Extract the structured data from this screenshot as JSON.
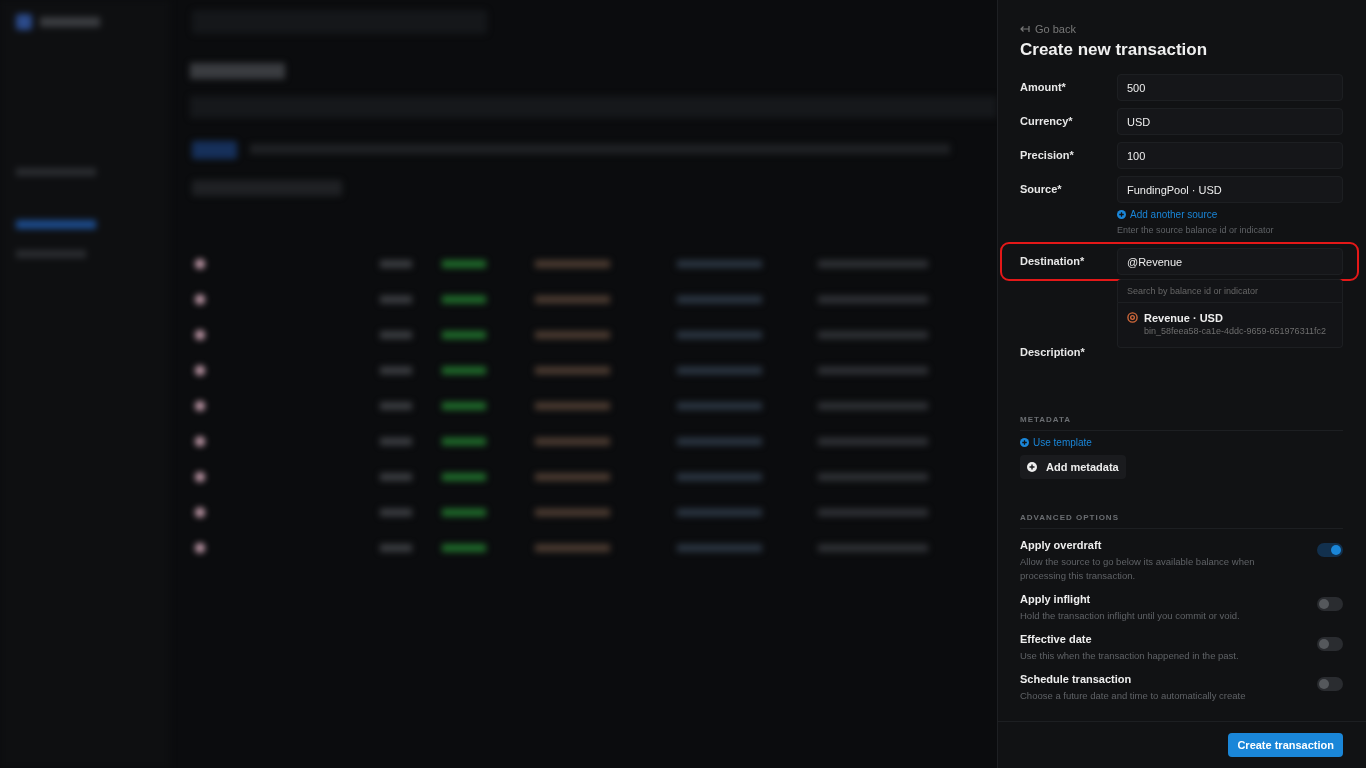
{
  "panel": {
    "back_link": "Go back",
    "title": "Create new transaction",
    "fields": [
      {
        "label": "Amount*",
        "value": "500",
        "highlighted": false
      },
      {
        "label": "Currency*",
        "value": "USD",
        "highlighted": false
      },
      {
        "label": "Precision*",
        "value": "100",
        "highlighted": false
      },
      {
        "label": "Source*",
        "value": "FundingPool · USD",
        "highlighted": false,
        "add_link": "Add another source",
        "hint": "Enter the source balance id or indicator"
      },
      {
        "label": "Destination*",
        "value": "@Revenue",
        "highlighted": true,
        "dropdown": {
          "placeholder": "Search by balance id or indicator",
          "options": [
            {
              "name": "Revenue · USD",
              "id": "bin_58feea58-ca1e-4ddc-9659-651976311fc2"
            }
          ]
        }
      },
      {
        "label": "Description*",
        "highlighted": false
      }
    ],
    "metadata": {
      "heading": "METADATA",
      "template_link": "Use template",
      "add_button": "Add metadata"
    },
    "advanced": {
      "heading": "ADVANCED OPTIONS",
      "options": [
        {
          "title": "Apply overdraft",
          "description": "Allow the source to go below its available balance when processing this transaction.",
          "on": true
        },
        {
          "title": "Apply inflight",
          "description": "Hold the transaction inflight until you commit or void.",
          "on": false
        },
        {
          "title": "Effective date",
          "description": "Use this when the transaction happened in the past.",
          "on": false
        },
        {
          "title": "Schedule transaction",
          "description": "Choose a future date and time to automatically create",
          "on": false
        }
      ]
    },
    "submit_button": "Create transaction"
  }
}
